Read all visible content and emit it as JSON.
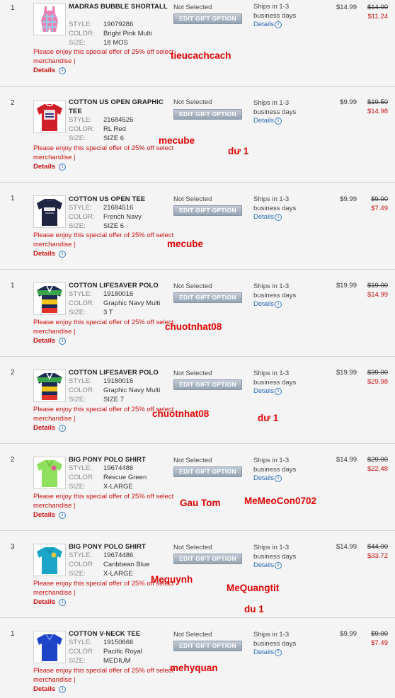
{
  "labels": {
    "style": "STYLE:",
    "color": "COLOR:",
    "size": "SIZE:"
  },
  "items": [
    {
      "qty": "1",
      "name": "MADRAS BUBBLE SHORTALL",
      "style": "19079286",
      "color": "Bright Pink Multi",
      "size": "18 MOS",
      "offer": "Please enjoy this special offer of 25% off select merchandise |",
      "details": "Details",
      "gift_status": "Not Selected",
      "gift_button": "EDIT GIFT OPTION",
      "ship": "Ships in 1-3 business days",
      "ship_details": "Details",
      "price": "$14.99",
      "orig_price": "$14.00",
      "sale_price": "$11.24",
      "notes": [
        "tieucachcach"
      ],
      "product_icon": "romper-icon",
      "colors": [
        "#e97fb1",
        "#9fc6e6"
      ]
    },
    {
      "qty": "2",
      "name": "COTTON US OPEN GRAPHIC TEE",
      "style": "21684526",
      "color": "RL Red",
      "size": "SIZE 6",
      "offer": "Please enjoy this special offer of 25% off select merchandise |",
      "details": "Details",
      "gift_status": "Not Selected",
      "gift_button": "EDIT GIFT OPTION",
      "ship": "Ships in 1-3 business days",
      "ship_details": "Details",
      "price": "$9.99",
      "orig_price": "$19.50",
      "sale_price": "$14.98",
      "notes": [
        "mecube",
        "dư 1"
      ],
      "product_icon": "red-tee-icon",
      "colors": [
        "#d11f2a",
        "#ffffff"
      ]
    },
    {
      "qty": "1",
      "name": "COTTON US OPEN TEE",
      "style": "21684516",
      "color": "French Navy",
      "size": "SIZE 6",
      "offer": "Please enjoy this special offer of 25% off select merchandise |",
      "details": "Details",
      "gift_status": "Not Selected",
      "gift_button": "EDIT GIFT OPTION",
      "ship": "Ships in 1-3 business days",
      "ship_details": "Details",
      "price": "$9.99",
      "orig_price": "$9.00",
      "sale_price": "$7.49",
      "notes": [
        "mecube"
      ],
      "product_icon": "navy-tee-icon",
      "colors": [
        "#1f2540",
        "#ffffff"
      ]
    },
    {
      "qty": "1",
      "name": "COTTON LIFESAVER POLO",
      "style": "19180016",
      "color": "Graphic Navy Multi",
      "size": "3 T",
      "offer": "Please enjoy this special offer of 25% off select merchandise |",
      "details": "Details",
      "gift_status": "Not Selected",
      "gift_button": "EDIT GIFT OPTION",
      "ship": "Ships in 1-3 business days",
      "ship_details": "Details",
      "price": "$19.99",
      "orig_price": "$19.00",
      "sale_price": "$14.99",
      "notes": [
        "chuotnhat08"
      ],
      "product_icon": "striped-polo-icon",
      "colors": [
        "#1d2a55",
        "#3aa64a",
        "#f0c419",
        "#e0322b"
      ]
    },
    {
      "qty": "2",
      "name": "COTTON LIFESAVER POLO",
      "style": "19180016",
      "color": "Graphic Navy Multi",
      "size": "SIZE 7",
      "offer": "Please enjoy this special offer of 25% off select merchandise |",
      "details": "Details",
      "gift_status": "Not Selected",
      "gift_button": "EDIT GIFT OPTION",
      "ship": "Ships in 1-3 business days",
      "ship_details": "Details",
      "price": "$19.99",
      "orig_price": "$39.00",
      "sale_price": "$29.98",
      "notes": [
        "chuotnhat08",
        "dư 1"
      ],
      "product_icon": "striped-polo-icon",
      "colors": [
        "#1d2a55",
        "#3aa64a",
        "#f0c419",
        "#e0322b"
      ]
    },
    {
      "qty": "2",
      "name": "BIG PONY POLO SHIRT",
      "style": "19674486",
      "color": "Rescue Green",
      "size": "X-LARGE",
      "offer": "Please enjoy this special offer of 25% off select merchandise |",
      "details": "Details",
      "gift_status": "Not Selected",
      "gift_button": "EDIT GIFT OPTION",
      "ship": "Ships in 1-3 business days",
      "ship_details": "Details",
      "price": "$14.99",
      "orig_price": "$29.00",
      "sale_price": "$22.48",
      "notes": [
        "Gau Tom",
        "MeMeoCon0702"
      ],
      "product_icon": "green-polo-icon",
      "colors": [
        "#8fe05c",
        "#e05a9a"
      ]
    },
    {
      "qty": "3",
      "name": "BIG PONY POLO SHIRT",
      "style": "19674486",
      "color": "Caribbean Blue",
      "size": "X-LARGE",
      "offer": "Please enjoy this special offer of 25% off select merchandise |",
      "details": "Details",
      "gift_status": "Not Selected",
      "gift_button": "EDIT GIFT OPTION",
      "ship": "Ships in 1-3 business days",
      "ship_details": "Details",
      "price": "$14.99",
      "orig_price": "$44.00",
      "sale_price": "$33.72",
      "notes": [
        "Mequynh",
        "MeQuangtit",
        "du 1"
      ],
      "product_icon": "blue-polo-icon",
      "colors": [
        "#1aa5c9",
        "#e8c83a"
      ]
    },
    {
      "qty": "1",
      "name": "COTTON V-NECK TEE",
      "style": "19150666",
      "color": "Pacific Royal",
      "size": "MEDIUM",
      "offer": "Please enjoy this special offer of 25% off select merchandise |",
      "details": "Details",
      "gift_status": "Not Selected",
      "gift_button": "EDIT GIFT OPTION",
      "ship": "Ships in 1-3 business days",
      "ship_details": "Details",
      "price": "$9.99",
      "orig_price": "$9.00",
      "sale_price": "$7.49",
      "notes": [
        "mehyquan"
      ],
      "product_icon": "royal-vneck-icon",
      "colors": [
        "#1e45c8",
        "#ffffff"
      ]
    }
  ]
}
